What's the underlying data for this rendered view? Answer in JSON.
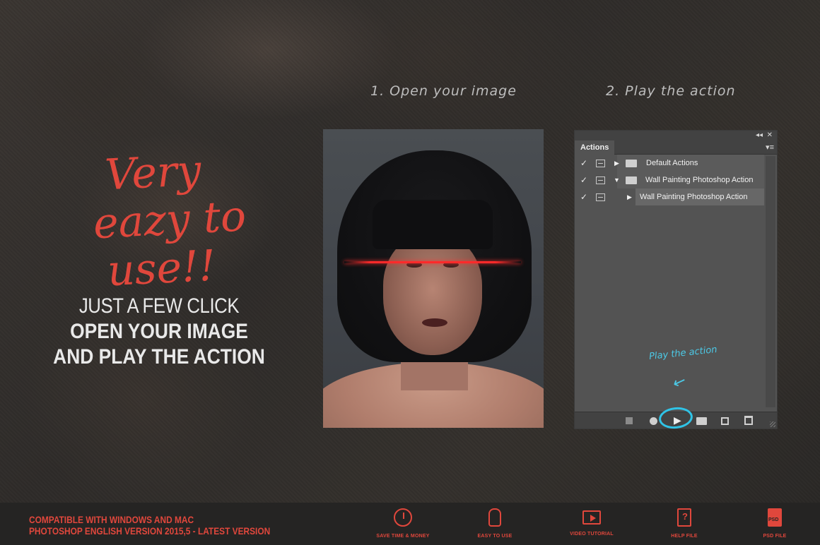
{
  "steps": {
    "step1": "1. Open your image",
    "step2": "2. Play the action"
  },
  "headline": {
    "line1": "Very",
    "line2": "eazy to",
    "line3": "use!!"
  },
  "promo": {
    "line1": "JUST A FEW CLICK",
    "line2": "OPEN YOUR IMAGE",
    "line3": "AND PLAY THE ACTION"
  },
  "actions_panel": {
    "tab_label": "Actions",
    "collapse_icon": "double-chevron-left-icon",
    "close_icon": "close-icon",
    "rows": [
      {
        "checked": true,
        "label": "Default Actions",
        "expanded": false,
        "type": "set"
      },
      {
        "checked": true,
        "label": "Wall Painting Photoshop Action",
        "expanded": true,
        "type": "set"
      },
      {
        "checked": true,
        "label": "Wall Painting Photoshop Action",
        "expanded": false,
        "type": "action",
        "selected": true
      }
    ],
    "bottom_buttons": [
      "stop-icon",
      "record-icon",
      "play-icon",
      "new-set-icon",
      "new-action-icon",
      "trash-icon"
    ]
  },
  "annotation": {
    "text": "Play the action"
  },
  "footer": {
    "line1": "COMPATIBLE WITH WINDOWS AND MAC",
    "line2": "PHOTOSHOP ENGLISH VERSION 2015,5 - LATEST VERSION",
    "features": [
      {
        "icon": "clock-money-icon",
        "label": "SAVE TIME & MONEY"
      },
      {
        "icon": "hand-click-icon",
        "label": "EASY TO USE"
      },
      {
        "icon": "video-icon",
        "label": "VIDEO TUTORIAL"
      },
      {
        "icon": "help-file-icon",
        "label": "HELP FILE"
      },
      {
        "icon": "psd-file-icon",
        "label": "PSD FILE"
      }
    ]
  },
  "colors": {
    "accent": "#e0473c",
    "annotation": "#4cc9e6",
    "panel": "#535353"
  }
}
